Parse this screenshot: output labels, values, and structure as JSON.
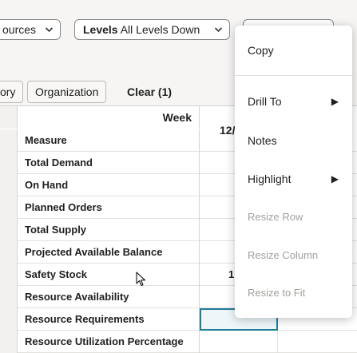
{
  "toolbar": {
    "resources_dropdown": {
      "label": "ources"
    },
    "levels_dropdown": {
      "label": "Levels",
      "value": "All Levels Down"
    },
    "chips": [
      "ory",
      "Organization"
    ],
    "clear_label": "Clear (1)"
  },
  "grid": {
    "header_label": "Week",
    "column_header": "12/",
    "measure_header": "Measure",
    "rows": [
      {
        "label": "Total Demand",
        "value": ""
      },
      {
        "label": "On Hand",
        "value": ""
      },
      {
        "label": "Planned Orders",
        "value": ""
      },
      {
        "label": "Total Supply",
        "value": ""
      },
      {
        "label": "Projected Available Balance",
        "value": ""
      },
      {
        "label": "Safety Stock",
        "value": "1"
      },
      {
        "label": "Resource Availability",
        "value": ""
      },
      {
        "label": "Resource Requirements",
        "value": ""
      },
      {
        "label": "Resource Utilization Percentage",
        "value": ""
      }
    ]
  },
  "context_menu": {
    "items": [
      {
        "label": "Copy",
        "enabled": true,
        "submenu": false
      },
      {
        "label": "Drill To",
        "enabled": true,
        "submenu": true
      },
      {
        "label": "Notes",
        "enabled": true,
        "submenu": false
      },
      {
        "label": "Highlight",
        "enabled": true,
        "submenu": true
      },
      {
        "label": "Resize Row",
        "enabled": false,
        "submenu": false
      },
      {
        "label": "Resize Column",
        "enabled": false,
        "submenu": false
      },
      {
        "label": "Resize to Fit",
        "enabled": false,
        "submenu": false
      }
    ],
    "submenu_arrow": "▶"
  },
  "icons": {
    "chevron": "chevron-down-icon",
    "arrow": "arrow-right-icon",
    "cursor": "mouse-pointer-icon"
  }
}
